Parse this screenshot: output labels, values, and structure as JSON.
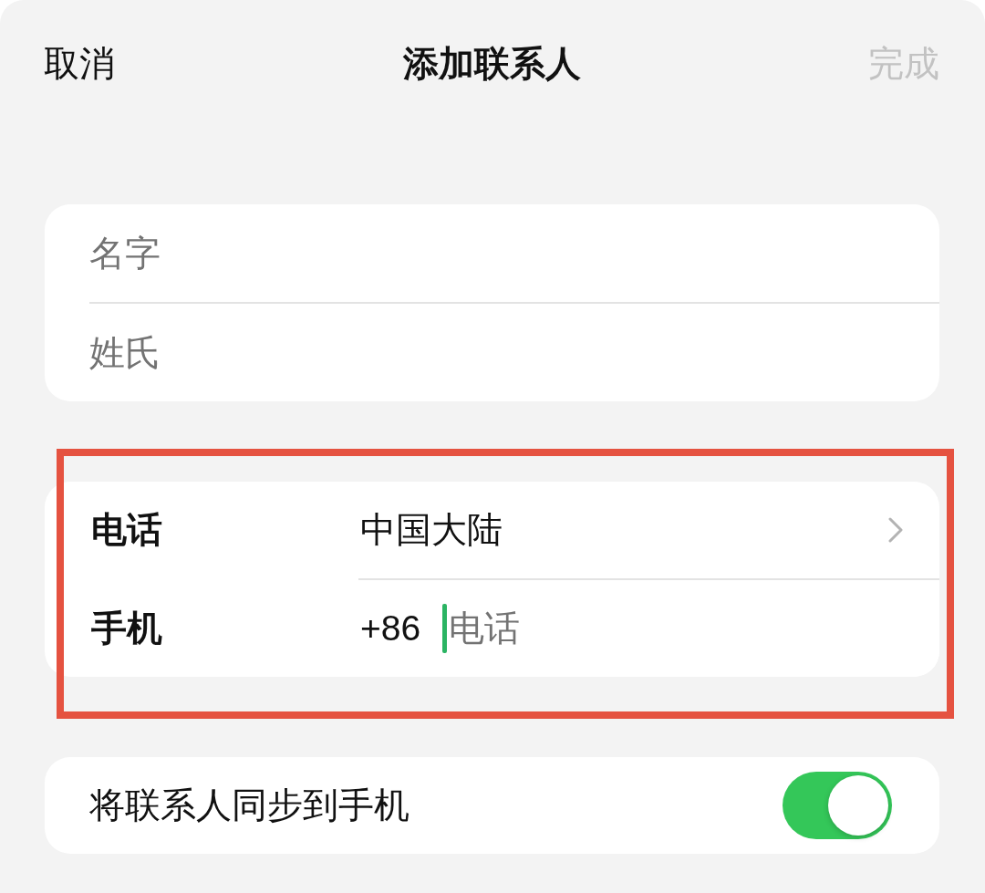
{
  "nav_bar": {
    "cancel": "取消",
    "title": "添加联系人",
    "done": "完成",
    "done_disabled": true
  },
  "name_fields": [
    {
      "placeholder": "名字"
    },
    {
      "placeholder": "姓氏"
    }
  ],
  "phone_section": {
    "highlighted": true,
    "rows": [
      {
        "kind": "picker",
        "label": "电话",
        "value": "中国大陆"
      },
      {
        "kind": "input",
        "label": "手机",
        "prefix": "+86",
        "placeholder": "电话",
        "focused": true
      }
    ]
  },
  "sync_row": {
    "label": "将联系人同步到手机",
    "on": true
  }
}
